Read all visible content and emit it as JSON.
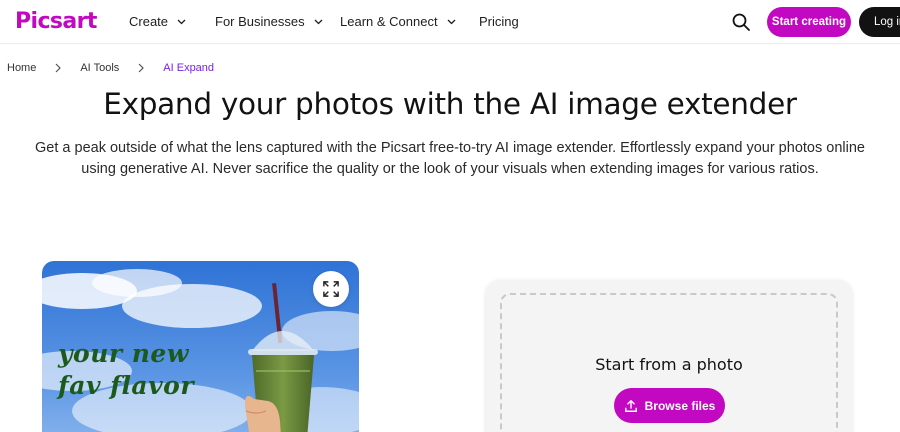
{
  "brand": {
    "logo_text": "Picsart",
    "accent_color": "#c209c1"
  },
  "nav": {
    "items": [
      {
        "label": "Create",
        "has_dropdown": true
      },
      {
        "label": "For Businesses",
        "has_dropdown": true
      },
      {
        "label": "Learn & Connect",
        "has_dropdown": true
      },
      {
        "label": "Pricing",
        "has_dropdown": false
      }
    ],
    "search_icon": "search-icon",
    "start_creating_label": "Start creating",
    "login_label": "Log in"
  },
  "breadcrumb": [
    {
      "label": "Home"
    },
    {
      "label": "AI Tools"
    },
    {
      "label": "AI Expand",
      "current": true
    }
  ],
  "hero": {
    "title": "Expand your photos with the AI image extender",
    "description": "Get a peak outside of what the lens captured with the Picsart free-to-try AI image extender. Effortlessly expand your photos online using generative AI. Never sacrifice the quality or the look of your visuals when extending images for various ratios."
  },
  "preview": {
    "promo_line1": "your new",
    "promo_line2": "fav flavor",
    "expand_icon": "expand-icon"
  },
  "upload": {
    "title": "Start from a photo",
    "browse_label": "Browse files",
    "upload_icon": "upload-icon"
  }
}
